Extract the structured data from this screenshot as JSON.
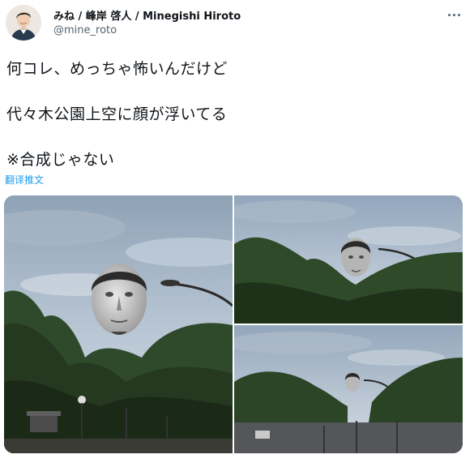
{
  "author": {
    "display_name": "みね / 峰岸 啓人 / Minegishi Hiroto",
    "handle": "@mine_roto"
  },
  "tweet": {
    "lines": [
      "何コレ、めっちゃ怖いんだけど",
      "代々木公園上空に顔が浮いてる",
      "※合成じゃない"
    ],
    "translate_label": "翻译推文"
  },
  "icons": {
    "more": "more-options-icon",
    "avatar": "user-avatar"
  },
  "colors": {
    "text": "#0f1419",
    "secondary": "#536471",
    "link": "#1d9bf0"
  },
  "media": {
    "count": 3
  }
}
